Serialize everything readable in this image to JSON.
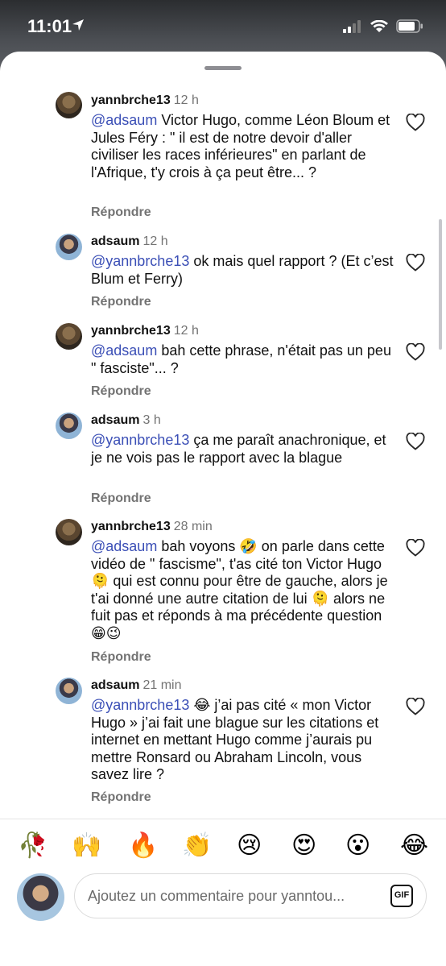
{
  "status": {
    "time": "11:01"
  },
  "comments": [
    {
      "user": "yannbrche13",
      "time": "12 h",
      "avatar": "y",
      "mention": "@adsaum",
      "text": " Victor Hugo, comme Léon Bloum et Jules Féry : \" il est de notre devoir d'aller civiliser les races inférieures\" en parlant de l'Afrique, t'y crois à ça peut être... ?",
      "reply": "Répondre"
    },
    {
      "user": "adsaum",
      "time": "12 h",
      "avatar": "a",
      "mention": "@yannbrche13",
      "text": " ok mais quel rapport ? (Et c’est Blum et Ferry)",
      "reply": "Répondre"
    },
    {
      "user": "yannbrche13",
      "time": "12 h",
      "avatar": "y",
      "mention": "@adsaum",
      "text": " bah cette phrase, n'était pas un peu \" fasciste\"... ?",
      "reply": "Répondre"
    },
    {
      "user": "adsaum",
      "time": "3 h",
      "avatar": "a",
      "mention": "@yannbrche13",
      "text": " ça me paraît anachronique, et je ne vois pas le rapport avec la blague",
      "reply": "Répondre"
    },
    {
      "user": "yannbrche13",
      "time": "28 min",
      "avatar": "y",
      "mention": "@adsaum",
      "text": " bah voyons 🤣 on parle dans cette vidéo de \" fascisme\", t'as cité ton Victor Hugo 🫠 qui est connu pour être de gauche, alors je t'ai donné une autre citation de lui 🫠  alors ne fuit pas et réponds à ma précédente question 😁😉",
      "reply": "Répondre"
    },
    {
      "user": "adsaum",
      "time": "21 min",
      "avatar": "a",
      "mention": "@yannbrche13",
      "text": " 😂 j’ai pas cité « mon Victor Hugo » j’ai fait une blague sur les citations et internet en mettant Hugo comme j’aurais pu mettre Ronsard ou Abraham Lincoln, vous savez lire ?",
      "reply": "Répondre"
    }
  ],
  "emojis": [
    "🥀",
    "🙌",
    "🔥",
    "👏",
    "😢",
    "😍",
    "😮",
    "😂"
  ],
  "input": {
    "placeholder": "Ajoutez un commentaire pour yanntou...",
    "gif_label": "GIF"
  },
  "icons": {
    "heart": "heart-outline-icon",
    "location": "location-arrow-icon",
    "signal": "cellular-signal-icon",
    "wifi": "wifi-icon",
    "battery": "battery-icon"
  }
}
